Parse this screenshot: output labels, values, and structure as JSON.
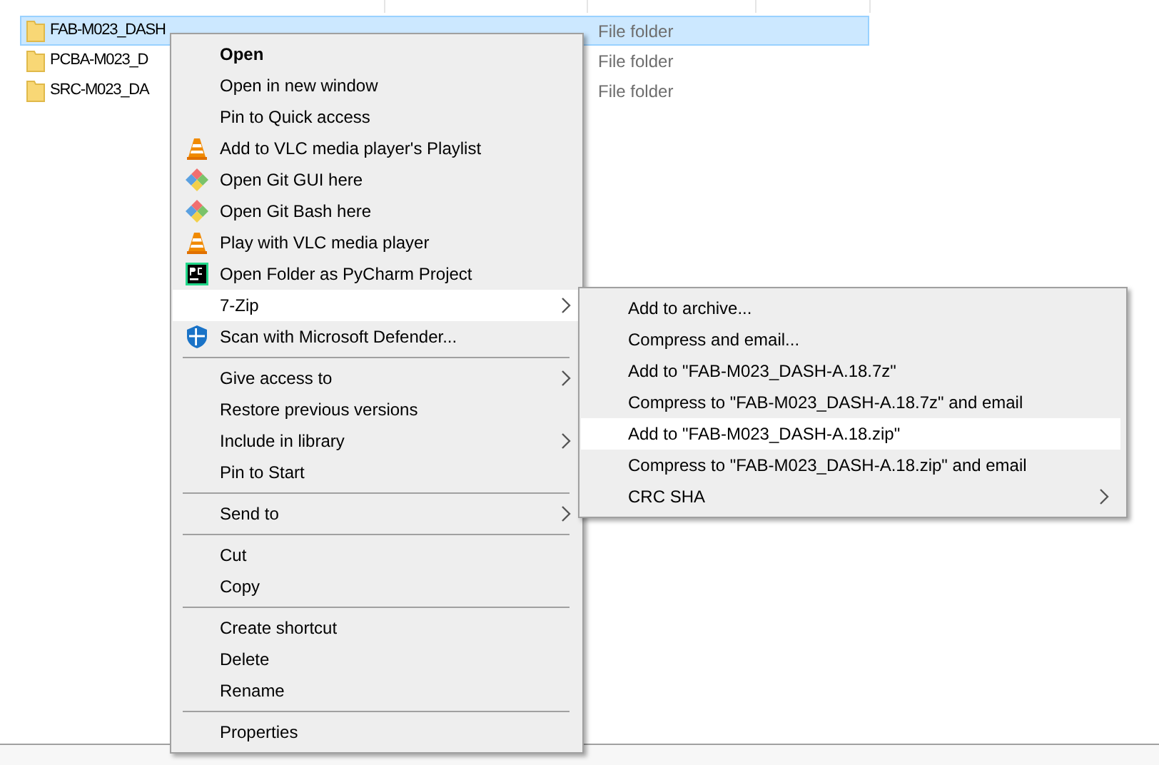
{
  "files": [
    {
      "name": "FAB-M023_DASH",
      "type": "File folder",
      "selected": true
    },
    {
      "name": "PCBA-M023_D",
      "type": "File folder",
      "selected": false
    },
    {
      "name": "SRC-M023_DA",
      "type": "File folder",
      "selected": false
    }
  ],
  "context_menu": {
    "items": [
      {
        "kind": "plain",
        "label": "Open",
        "default": true,
        "submenu": false,
        "selected": false
      },
      {
        "kind": "plain",
        "label": "Open in new window",
        "default": false,
        "submenu": false,
        "selected": false
      },
      {
        "kind": "plain",
        "label": "Pin to Quick access",
        "default": false,
        "submenu": false,
        "selected": false
      },
      {
        "kind": "cone",
        "label": "Add to VLC media player's Playlist",
        "default": false,
        "submenu": false,
        "selected": false
      },
      {
        "kind": "git",
        "label": "Open Git GUI here",
        "default": false,
        "submenu": false,
        "selected": false
      },
      {
        "kind": "git",
        "label": "Open Git Bash here",
        "default": false,
        "submenu": false,
        "selected": false
      },
      {
        "kind": "cone",
        "label": "Play with VLC media player",
        "default": false,
        "submenu": false,
        "selected": false
      },
      {
        "kind": "ide",
        "label": "Open Folder as PyCharm Project",
        "default": false,
        "submenu": false,
        "selected": false
      },
      {
        "kind": "plain",
        "label": "7-Zip",
        "default": false,
        "submenu": true,
        "selected": true
      },
      {
        "kind": "shield",
        "label": "Scan with Microsoft Defender...",
        "default": false,
        "submenu": false,
        "selected": false
      },
      {
        "kind": "separator"
      },
      {
        "kind": "plain",
        "label": "Give access to",
        "default": false,
        "submenu": true,
        "selected": false
      },
      {
        "kind": "plain",
        "label": "Restore previous versions",
        "default": false,
        "submenu": false,
        "selected": false
      },
      {
        "kind": "plain",
        "label": "Include in library",
        "default": false,
        "submenu": true,
        "selected": false
      },
      {
        "kind": "plain",
        "label": "Pin to Start",
        "default": false,
        "submenu": false,
        "selected": false
      },
      {
        "kind": "separator"
      },
      {
        "kind": "plain",
        "label": "Send to",
        "default": false,
        "submenu": true,
        "selected": false
      },
      {
        "kind": "separator"
      },
      {
        "kind": "plain",
        "label": "Cut",
        "default": false,
        "submenu": false,
        "selected": false
      },
      {
        "kind": "plain",
        "label": "Copy",
        "default": false,
        "submenu": false,
        "selected": false
      },
      {
        "kind": "separator"
      },
      {
        "kind": "plain",
        "label": "Create shortcut",
        "default": false,
        "submenu": false,
        "selected": false
      },
      {
        "kind": "plain",
        "label": "Delete",
        "default": false,
        "submenu": false,
        "selected": false
      },
      {
        "kind": "plain",
        "label": "Rename",
        "default": false,
        "submenu": false,
        "selected": false
      },
      {
        "kind": "separator"
      },
      {
        "kind": "plain",
        "label": "Properties",
        "default": false,
        "submenu": false,
        "selected": false
      }
    ]
  },
  "submenu": {
    "items": [
      {
        "label": "Add to archive...",
        "submenu": false,
        "selected": false
      },
      {
        "label": "Compress and email...",
        "submenu": false,
        "selected": false
      },
      {
        "label": "Add to \"FAB-M023_DASH-A.18.7z\"",
        "submenu": false,
        "selected": false
      },
      {
        "label": "Compress to \"FAB-M023_DASH-A.18.7z\" and email",
        "submenu": false,
        "selected": false
      },
      {
        "label": "Add to \"FAB-M023_DASH-A.18.zip\"",
        "submenu": false,
        "selected": true
      },
      {
        "label": "Compress to \"FAB-M023_DASH-A.18.zip\" and email",
        "submenu": false,
        "selected": false
      },
      {
        "label": "CRC SHA",
        "submenu": true,
        "selected": false
      }
    ]
  }
}
